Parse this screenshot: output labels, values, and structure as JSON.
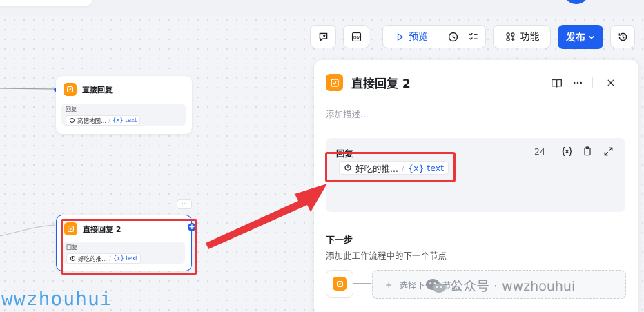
{
  "toolbar": {
    "preview_label": "预览",
    "feature_label": "功能",
    "publish_label": "发布"
  },
  "canvas": {
    "node1": {
      "title": "直接回复",
      "field_label": "回复",
      "ref_source": "高德地图...",
      "ref_var": "{x} text"
    },
    "node2": {
      "title": "直接回复 2",
      "field_label": "回复",
      "ref_source": "好吃的推...",
      "ref_var": "{x} text",
      "more_label": "···"
    }
  },
  "panel": {
    "title": "直接回复 2",
    "description_placeholder": "添加描述...",
    "reply": {
      "label": "回复",
      "char_count": "24",
      "ref_source": "好吃的推...",
      "ref_var": "{x} text"
    },
    "next_step": {
      "title": "下一步",
      "description": "添加此工作流程中的下一个节点",
      "select_label": "选择下一个节点"
    }
  },
  "watermarks": {
    "left": "wwzhouhui",
    "right": "公众号 · wwzhouhui"
  },
  "colors": {
    "accent": "#1f5ff0",
    "reply_node": "#ff9810",
    "annotation": "#e8363a"
  }
}
